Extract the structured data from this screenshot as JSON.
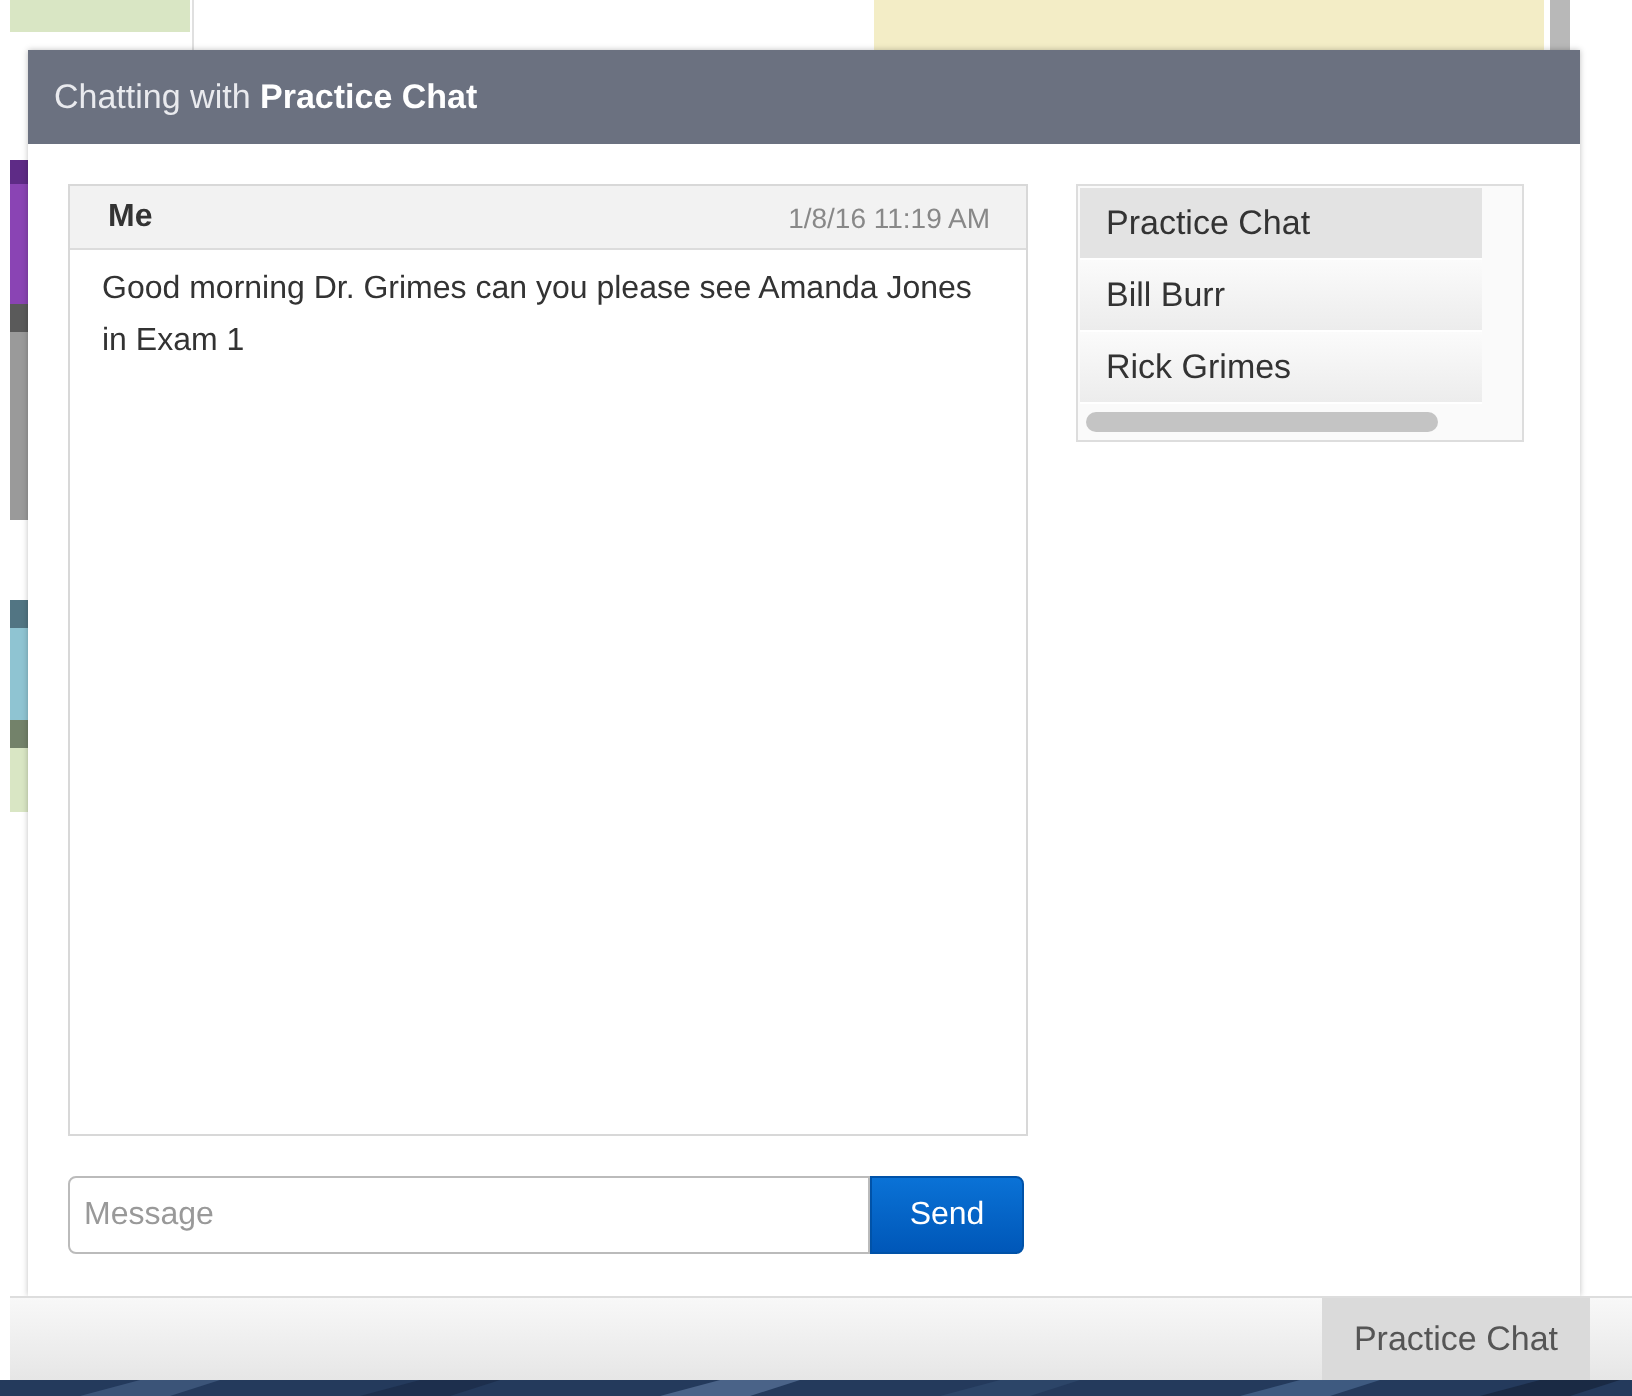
{
  "window": {
    "title": "Chatting with **Practice Chat**"
  },
  "messages": [
    {
      "sender": "Me",
      "time": "1/8/16 11:19 AM",
      "text": "Good morning Dr. Grimes can you please see Amanda Jones in Exam 1"
    }
  ],
  "conversations": [
    {
      "label": "Practice Chat",
      "selected": true
    },
    {
      "label": "Bill Burr",
      "selected": false
    },
    {
      "label": "Rick Grimes",
      "selected": false
    }
  ],
  "composer": {
    "placeholder": "Message",
    "button": "Send"
  },
  "taskbar": {
    "tabs": [
      {
        "label": "Practice Chat",
        "selected": true
      }
    ]
  }
}
